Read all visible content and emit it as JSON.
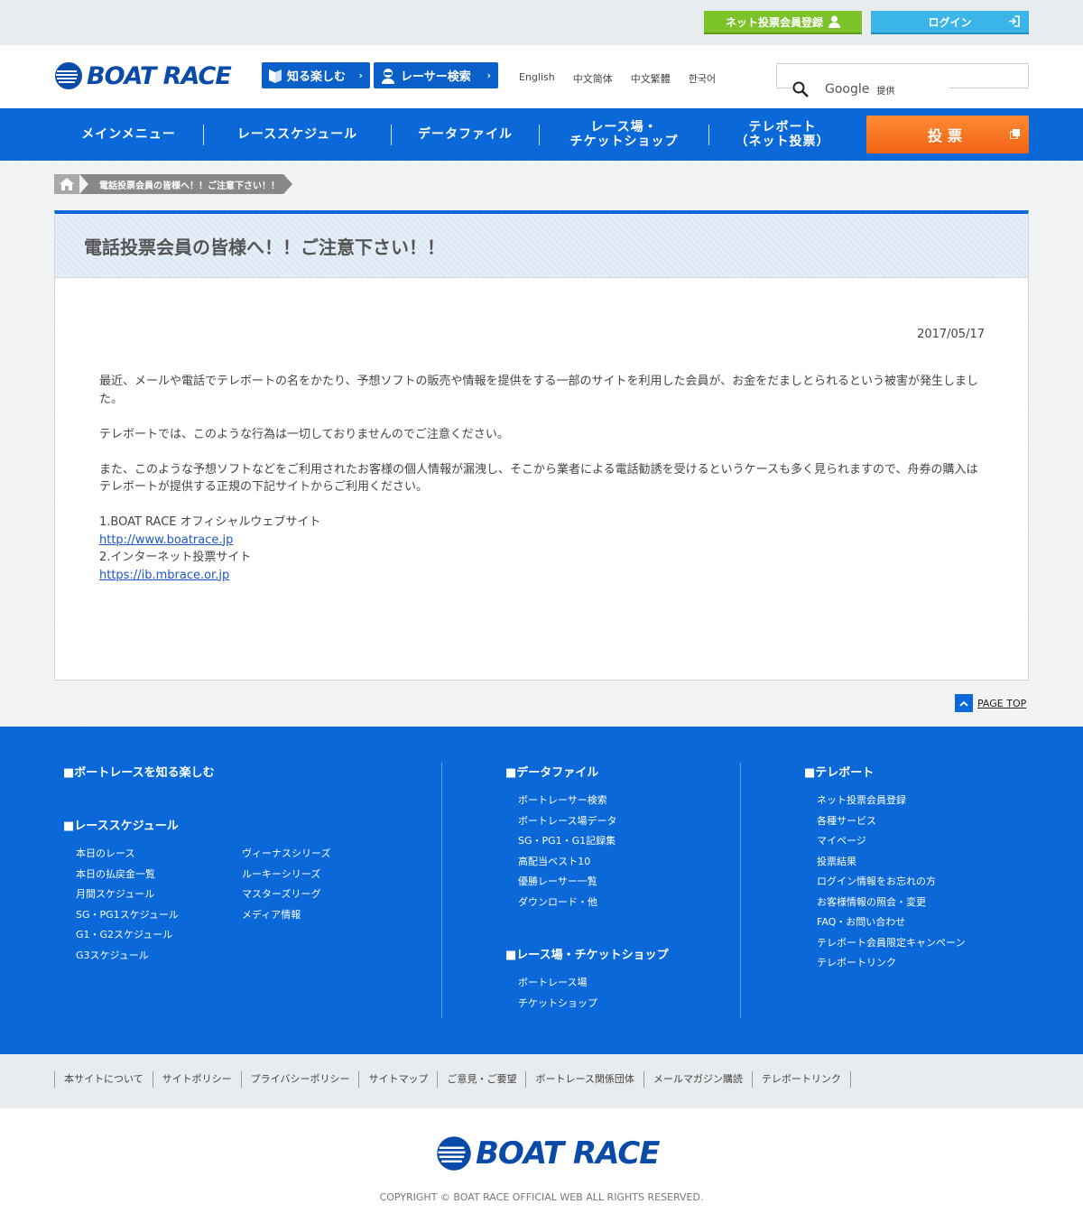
{
  "topbar": {
    "register_label": "ネット投票会員登録",
    "login_label": "ログイン"
  },
  "header": {
    "logo": "BOAT RACE",
    "btn_enjoy": "知る楽しむ",
    "btn_racer": "レーサー検索",
    "langs": [
      "English",
      "中文简体",
      "中文繁體",
      "한국어"
    ],
    "search": {
      "placeholder": "",
      "google": "Google",
      "provided": "提供"
    }
  },
  "gnav": {
    "items": [
      "メインメニュー",
      "レーススケジュール",
      "データファイル",
      "レース場・チケットショップ",
      "テレボート（ネット投票）"
    ],
    "item4_l1": "レース場・",
    "item4_l2": "チケットショップ",
    "item5_l1": "テレボート",
    "item5_l2": "（ネット投票）",
    "vote": "投票"
  },
  "breadcrumb": {
    "current": "電話投票会員の皆様へ！！ご注意下さい！！"
  },
  "article": {
    "title": "電話投票会員の皆様へ！！ご注意下さい！！",
    "date": "2017/05/17",
    "p1": "最近、メールや電話でテレボートの名をかたり、予想ソフトの販売や情報を提供をする一部のサイトを利用した会員が、お金をだましとられるという被害が発生しました。",
    "p2": "テレボートでは、このような行為は一切しておりませんのでご注意ください。",
    "p3": "また、このような予想ソフトなどをご利用されたお客様の個人情報が漏洩し、そこから業者による電話勧誘を受けるというケースも多く見られますので、舟券の購入はテレボートが提供する正規の下記サイトからご利用ください。",
    "site1_label": "1.BOAT RACE オフィシャルウェブサイト",
    "site1_url": "http://www.boatrace.jp",
    "site2_label": "2.インターネット投票サイト",
    "site2_url": "https://ib.mbrace.or.jp"
  },
  "pagetop": "PAGE TOP",
  "footer": {
    "h_enjoy": "■ボートレースを知る楽しむ",
    "h_schedule": "■レーススケジュール",
    "schedule_left": [
      "本日のレース",
      "本日の払戻金一覧",
      "月間スケジュール",
      "SG・PG1スケジュール",
      "G1・G2スケジュール",
      "G3スケジュール"
    ],
    "schedule_right": [
      "ヴィーナスシリーズ",
      "ルーキーシリーズ",
      "マスターズリーグ",
      "メディア情報"
    ],
    "h_data": "■データファイル",
    "data_links": [
      "ボートレーサー検索",
      "ボートレース場データ",
      "SG・PG1・G1記録集",
      "高配当ベスト10",
      "優勝レーサー一覧",
      "ダウンロード・他"
    ],
    "h_venue": "■レース場・チケットショップ",
    "venue_links": [
      "ボートレース場",
      "チケットショップ"
    ],
    "h_teleboat": "■テレボート",
    "teleboat_links": [
      "ネット投票会員登録",
      "各種サービス",
      "マイページ",
      "投票結果",
      "ログイン情報をお忘れの方",
      "お客様情報の照会・変更",
      "FAQ・お問い合わせ",
      "テレボート会員限定キャンペーン",
      "テレボートリンク"
    ]
  },
  "bottom_links": [
    "本サイトについて",
    "サイトポリシー",
    "プライバシーポリシー",
    "サイトマップ",
    "ご意見・ご要望",
    "ボートレース関係団体",
    "メールマガジン購読",
    "テレボートリンク"
  ],
  "footer_logo": "BOAT RACE",
  "copyright": "COPYRIGHT © BOAT RACE OFFICIAL WEB ALL RIGHTS RESERVED.",
  "colors": {
    "brand": "#0a68d8",
    "register": "#7cc32a",
    "login": "#3bb4e8",
    "vote": "#f26414"
  }
}
